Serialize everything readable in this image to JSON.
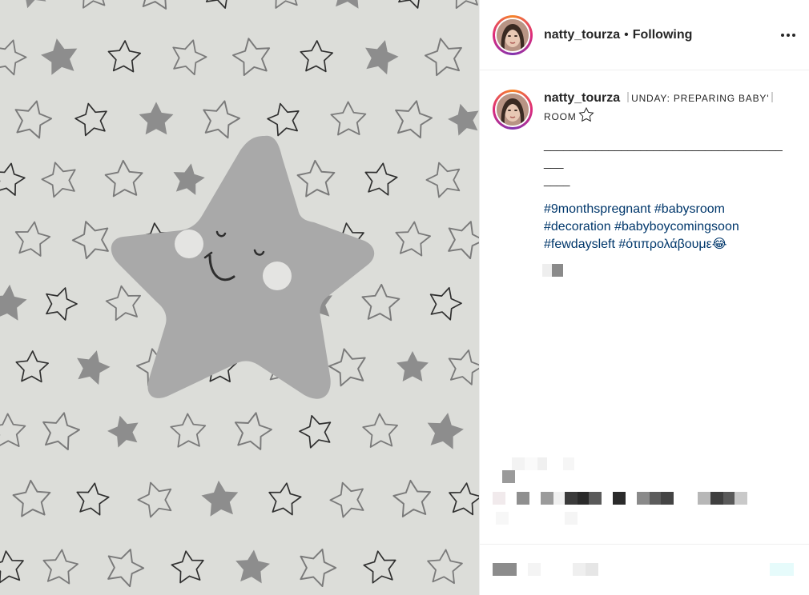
{
  "header": {
    "username": "natty_tourza",
    "separator": "•",
    "follow_status": "Following",
    "more_icon": "more-horizontal-icon"
  },
  "caption": {
    "username": "natty_tourza",
    "title_text": "UNDAY: PREPARING BABY",
    "title_tail": "ROOM",
    "title_icon": "star-outline-icon",
    "divider": "________________________________________",
    "divider_tail": "____",
    "hashtags": [
      "#9monthspregnant",
      "#babysroom",
      "#decoration",
      "#babyboycomingsoon",
      "#fewdaysleft",
      "#ότιπρολάβουμε😂"
    ]
  },
  "image": {
    "subject": "star-pattern-wallpaper"
  },
  "colors": {
    "hashtag": "#00376b",
    "text": "#262626",
    "border": "#efefef",
    "photo_bg": "#dfe0dc"
  }
}
